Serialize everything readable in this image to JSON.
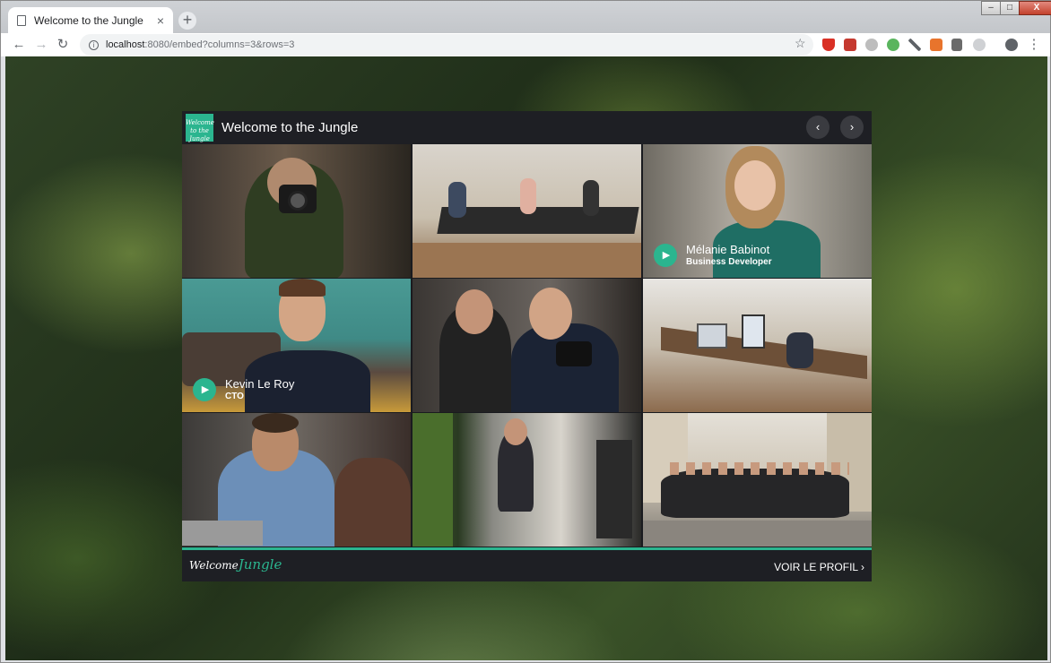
{
  "browser": {
    "tab_title": "Welcome to the Jungle",
    "tab_close": "×",
    "new_tab": "+",
    "url_host": "localhost",
    "url_path": ":8080/embed?columns=3&rows=3",
    "back": "←",
    "forward": "→",
    "reload": "↻",
    "star": "☆",
    "info": "i",
    "menu": "⋮",
    "window_controls": {
      "minimize": "–",
      "maximize": "□",
      "close": "X"
    }
  },
  "widget": {
    "logo_text": "Welcome to the Jungle",
    "title": "Welcome to the Jungle",
    "prev": "‹",
    "next": "›",
    "footer_logo": "Welcome",
    "footer_logo_script": "Jungle",
    "profile_link": "VOIR LE PROFIL ›",
    "accent_color": "#2bb58f",
    "cells": [
      {
        "scene": "photographer"
      },
      {
        "scene": "open-office"
      },
      {
        "scene": "portrait",
        "name": "Mélanie Babinot",
        "role": "Business Developer"
      },
      {
        "scene": "portrait",
        "name": "Kevin Le Roy",
        "role": "CTO"
      },
      {
        "scene": "camera-couple"
      },
      {
        "scene": "desks"
      },
      {
        "scene": "laptop-man"
      },
      {
        "scene": "phone-booth"
      },
      {
        "scene": "team-street"
      }
    ],
    "play_icon": "▶"
  }
}
